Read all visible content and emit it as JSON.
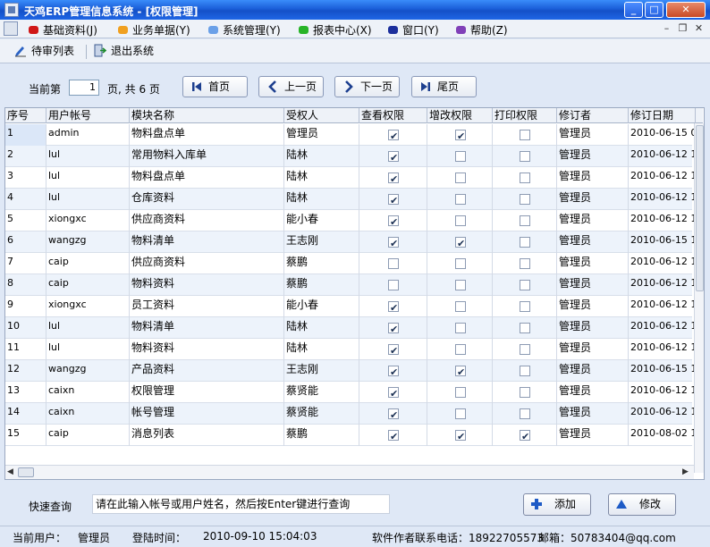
{
  "window": {
    "title": "天鸡ERP管理信息系统 - [权限管理]"
  },
  "menu": [
    {
      "label": "基础资料(J)",
      "color": "#d01818"
    },
    {
      "label": "业务单据(Y)",
      "color": "#f0a020"
    },
    {
      "label": "系统管理(Y)",
      "color": "#6aa0e8"
    },
    {
      "label": "报表中心(X)",
      "color": "#28b428"
    },
    {
      "label": "窗口(Y)",
      "color": "#1c2f9c"
    },
    {
      "label": "帮助(Z)",
      "color": "#8040b8"
    }
  ],
  "toolbar": {
    "pending_label": "待审列表",
    "exit_label": "退出系统"
  },
  "paging": {
    "current_prefix": "当前第",
    "current_page": "1",
    "suffix": "页, 共 6 页",
    "first": "首页",
    "prev": "上一页",
    "next": "下一页",
    "last": "尾页"
  },
  "grid": {
    "columns": [
      "序号",
      "用户帐号",
      "模块名称",
      "受权人",
      "查看权限",
      "增改权限",
      "打印权限",
      "修订者",
      "修订日期"
    ],
    "rows": [
      {
        "no": "1",
        "account": "admin",
        "module": "物料盘点单",
        "grantee": "管理员",
        "view": true,
        "edit": true,
        "print": false,
        "reviser": "管理员",
        "date": "2010-06-15 0"
      },
      {
        "no": "2",
        "account": "lul",
        "module": "常用物料入库单",
        "grantee": "陆林",
        "view": true,
        "edit": false,
        "print": false,
        "reviser": "管理员",
        "date": "2010-06-12 1"
      },
      {
        "no": "3",
        "account": "lul",
        "module": "物料盘点单",
        "grantee": "陆林",
        "view": true,
        "edit": false,
        "print": false,
        "reviser": "管理员",
        "date": "2010-06-12 1"
      },
      {
        "no": "4",
        "account": "lul",
        "module": "仓库资料",
        "grantee": "陆林",
        "view": true,
        "edit": false,
        "print": false,
        "reviser": "管理员",
        "date": "2010-06-12 1"
      },
      {
        "no": "5",
        "account": "xiongxc",
        "module": "供应商资料",
        "grantee": "能小春",
        "view": true,
        "edit": false,
        "print": false,
        "reviser": "管理员",
        "date": "2010-06-12 1"
      },
      {
        "no": "6",
        "account": "wangzg",
        "module": "物料清单",
        "grantee": "王志刚",
        "view": true,
        "edit": true,
        "print": false,
        "reviser": "管理员",
        "date": "2010-06-15 1"
      },
      {
        "no": "7",
        "account": "caip",
        "module": "供应商资料",
        "grantee": "蔡鹏",
        "view": false,
        "edit": false,
        "print": false,
        "reviser": "管理员",
        "date": "2010-06-12 1"
      },
      {
        "no": "8",
        "account": "caip",
        "module": "物料资料",
        "grantee": "蔡鹏",
        "view": false,
        "edit": false,
        "print": false,
        "reviser": "管理员",
        "date": "2010-06-12 1"
      },
      {
        "no": "9",
        "account": "xiongxc",
        "module": "员工资料",
        "grantee": "能小春",
        "view": true,
        "edit": false,
        "print": false,
        "reviser": "管理员",
        "date": "2010-06-12 1"
      },
      {
        "no": "10",
        "account": "lul",
        "module": "物料清单",
        "grantee": "陆林",
        "view": true,
        "edit": false,
        "print": false,
        "reviser": "管理员",
        "date": "2010-06-12 1"
      },
      {
        "no": "11",
        "account": "lul",
        "module": "物料资料",
        "grantee": "陆林",
        "view": true,
        "edit": false,
        "print": false,
        "reviser": "管理员",
        "date": "2010-06-12 1"
      },
      {
        "no": "12",
        "account": "wangzg",
        "module": "产品资料",
        "grantee": "王志刚",
        "view": true,
        "edit": true,
        "print": false,
        "reviser": "管理员",
        "date": "2010-06-15 1"
      },
      {
        "no": "13",
        "account": "caixn",
        "module": "权限管理",
        "grantee": "蔡贤能",
        "view": true,
        "edit": false,
        "print": false,
        "reviser": "管理员",
        "date": "2010-06-12 1"
      },
      {
        "no": "14",
        "account": "caixn",
        "module": "帐号管理",
        "grantee": "蔡贤能",
        "view": true,
        "edit": false,
        "print": false,
        "reviser": "管理员",
        "date": "2010-06-12 1"
      },
      {
        "no": "15",
        "account": "caip",
        "module": "消息列表",
        "grantee": "蔡鹏",
        "view": true,
        "edit": true,
        "print": true,
        "reviser": "管理员",
        "date": "2010-08-02 1"
      }
    ]
  },
  "quick": {
    "label": "快速查询",
    "placeholder": "请在此输入帐号或用户姓名，然后按Enter键进行查询",
    "add_label": "添加",
    "modify_label": "修改"
  },
  "status": {
    "user_label": "当前用户：",
    "user": "管理员",
    "login_label": "登陆时间：",
    "login_time": "2010-09-10 15:04:03",
    "contact": "软件作者联系电话：18922705573",
    "email": "邮箱：50783404@qq.com"
  }
}
